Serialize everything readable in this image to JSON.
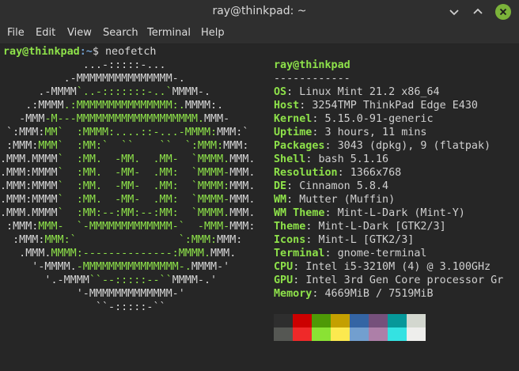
{
  "window": {
    "title": "ray@thinkpad: ~",
    "minimize_glyph": "⌄",
    "maximize_glyph": "⌃",
    "close_glyph": "✕",
    "icons": [
      "minimize-icon",
      "maximize-icon",
      "close-icon"
    ]
  },
  "menubar": {
    "items": [
      "File",
      "Edit",
      "View",
      "Search",
      "Terminal",
      "Help"
    ]
  },
  "prompt": {
    "user_host": "ray@thinkpad",
    "path": ":~",
    "symbol": "$ ",
    "command": "neofetch"
  },
  "logo": {
    "lines": [
      [
        [
          "w",
          "             ...-:::::-...             "
        ]
      ],
      [
        [
          "w",
          "          .-MMMMMMMMMMMMMMM-.          "
        ]
      ],
      [
        [
          "w",
          "      .-MMMM"
        ],
        [
          "g",
          "`..-:::::::-..`"
        ],
        [
          "w",
          "MMMM-.      "
        ]
      ],
      [
        [
          "w",
          "    .:MMMM"
        ],
        [
          "g",
          ".:MMMMMMMMMMMMMMM:."
        ],
        [
          "w",
          "MMMM:.    "
        ]
      ],
      [
        [
          "w",
          "   -MMM"
        ],
        [
          "g",
          "-M---MMMMMMMMMMMMMMMMMMM."
        ],
        [
          "w",
          "MMM-   "
        ]
      ],
      [
        [
          "w",
          " `:MMM:"
        ],
        [
          "g",
          "MM`  :MMMM:....::-...-MMMM:"
        ],
        [
          "w",
          "MMM:` "
        ]
      ],
      [
        [
          "w",
          " :MMM:"
        ],
        [
          "g",
          "MMM`  :MM:`  ``    ``  `:MMM:"
        ],
        [
          "w",
          "MMM: "
        ]
      ],
      [
        [
          "w",
          ".MMM.MMMM"
        ],
        [
          "g",
          "`  :MM.  -MM.  .MM-  `MMMM."
        ],
        [
          "w",
          "MMM."
        ]
      ],
      [
        [
          "w",
          ".MMM:MMMM"
        ],
        [
          "g",
          "`  :MM.  -MM-  .MM:  `MMMM-"
        ],
        [
          "w",
          "MMM."
        ]
      ],
      [
        [
          "w",
          ".MMM:MMMM"
        ],
        [
          "g",
          "`  :MM.  -MM-  .MM:  `MMMM:"
        ],
        [
          "w",
          "MMM."
        ]
      ],
      [
        [
          "w",
          ".MMM:MMMM"
        ],
        [
          "g",
          "`  :MM.  -MM-  .MM:  `MMMM-"
        ],
        [
          "w",
          "MMM."
        ]
      ],
      [
        [
          "w",
          ".MMM.MMMM"
        ],
        [
          "g",
          "`  :MM:--:MM:--:MM:  `MMMM."
        ],
        [
          "w",
          "MMM."
        ]
      ],
      [
        [
          "w",
          " :MMM:"
        ],
        [
          "g",
          "MMM-  `-MMMMMMMMMMMMM-`  -MMM-"
        ],
        [
          "w",
          "MMM: "
        ]
      ],
      [
        [
          "w",
          "  :MMM:"
        ],
        [
          "g",
          "MMM:`                `:MMM:"
        ],
        [
          "w",
          "MMM:  "
        ]
      ],
      [
        [
          "w",
          "   .MMM."
        ],
        [
          "g",
          "MMMM:--------------:MMMM."
        ],
        [
          "w",
          "MMM.   "
        ]
      ],
      [
        [
          "w",
          "     '-MMMM."
        ],
        [
          "g",
          "-MMMMMMMMMMMMMMM-."
        ],
        [
          "w",
          "MMMM-'     "
        ]
      ],
      [
        [
          "w",
          "       '.-MMMM"
        ],
        [
          "g",
          "``--:::::--``"
        ],
        [
          "w",
          "MMMM-.'       "
        ]
      ],
      [
        [
          "w",
          "            '-MMMMMMMMMMMMM-'            "
        ]
      ],
      [
        [
          "w",
          "               ``-:::::-``               "
        ]
      ]
    ]
  },
  "info": {
    "header": "ray@thinkpad",
    "separator": "------------",
    "fields": [
      {
        "key": "OS",
        "value": "Linux Mint 21.2 x86_64"
      },
      {
        "key": "Host",
        "value": "3254TMP ThinkPad Edge E430"
      },
      {
        "key": "Kernel",
        "value": "5.15.0-91-generic"
      },
      {
        "key": "Uptime",
        "value": "3 hours, 11 mins"
      },
      {
        "key": "Packages",
        "value": "3043 (dpkg), 9 (flatpak)"
      },
      {
        "key": "Shell",
        "value": "bash 5.1.16"
      },
      {
        "key": "Resolution",
        "value": "1366x768"
      },
      {
        "key": "DE",
        "value": "Cinnamon 5.8.4"
      },
      {
        "key": "WM",
        "value": "Mutter (Muffin)"
      },
      {
        "key": "WM Theme",
        "value": "Mint-L-Dark (Mint-Y)"
      },
      {
        "key": "Theme",
        "value": "Mint-L-Dark [GTK2/3]"
      },
      {
        "key": "Icons",
        "value": "Mint-L [GTK2/3]"
      },
      {
        "key": "Terminal",
        "value": "gnome-terminal"
      },
      {
        "key": "CPU",
        "value": "Intel i5-3210M (4) @ 3.100GHz"
      },
      {
        "key": "GPU",
        "value": "Intel 3rd Gen Core processor Gr"
      },
      {
        "key": "Memory",
        "value": "4669MiB / 7519MiB"
      }
    ]
  },
  "palette": {
    "row1": [
      "#2e2e2e",
      "#cc0000",
      "#4e9a06",
      "#c4a000",
      "#3465a4",
      "#75507b",
      "#06989a",
      "#d3d7cf"
    ],
    "row2": [
      "#555753",
      "#ef2929",
      "#8ae234",
      "#fce94f",
      "#729fcf",
      "#ad7fa8",
      "#34e2e2",
      "#eeeeec"
    ]
  }
}
